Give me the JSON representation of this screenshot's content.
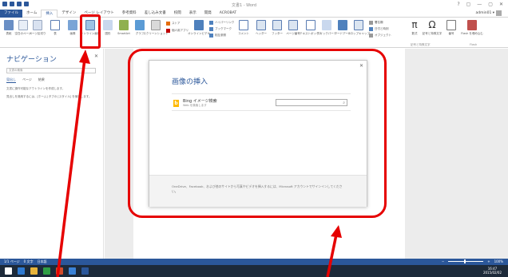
{
  "window": {
    "title": "文書1 - Word",
    "controls": [
      "?",
      "▢",
      "—",
      "▢",
      "✕"
    ]
  },
  "ribbon_tabs": [
    {
      "label": "ファイル",
      "kind": "file"
    },
    {
      "label": "ホーム",
      "kind": ""
    },
    {
      "label": "挿入",
      "kind": "active"
    },
    {
      "label": "デザイン",
      "kind": ""
    },
    {
      "label": "ページ レイアウト",
      "kind": ""
    },
    {
      "label": "参考資料",
      "kind": ""
    },
    {
      "label": "差し込み文書",
      "kind": ""
    },
    {
      "label": "校閲",
      "kind": ""
    },
    {
      "label": "表示",
      "kind": ""
    },
    {
      "label": "開発",
      "kind": ""
    },
    {
      "label": "ACROBAT",
      "kind": ""
    }
  ],
  "user": {
    "name": "admin01 ▾"
  },
  "ribbon": {
    "cover": "表紙",
    "blank": "空白のページ",
    "break": "ページ区切り",
    "table": "表",
    "picture": "画像",
    "online_picture": "オンライン画像",
    "shapes": "図形",
    "smartart": "SmartArt",
    "graph": "グラフ",
    "screenshot": "スクリーンショット",
    "store": "ストア",
    "my_apps": "個人用アプリ",
    "online_video": "オンラインビデオ",
    "link": "ハイパーリンク",
    "bookmark": "ブックマーク",
    "crossref": "相互参照",
    "comment": "コメント",
    "header": "ヘッダー",
    "footer": "フッター",
    "page_no": "ページ番号",
    "textbox": "テキストボックス",
    "quickparts": "クイックパーツ",
    "wordart": "ワードアート",
    "dropcap": "ドロップキャップ",
    "signature": "署名欄",
    "datetime": "日付と時刻",
    "object": "オブジェクト",
    "equation": "数式",
    "symbol": "記号と特殊文字",
    "number": "番号",
    "flash": "Flash を埋め込む",
    "group_symbols": "記号と特殊文字",
    "group_flash": "Flash",
    "equation_glyph": "π",
    "symbol_glyph": "Ω"
  },
  "navigation": {
    "title": "ナビゲーション",
    "search_placeholder": "文書の検索",
    "tabs": [
      "見出し",
      "ページ",
      "結果"
    ],
    "text1": "文書に操作可能なアウトラインを作成します。",
    "text2": "見出しを適用するには、[ホーム] タブの [スタイル] を使用します。",
    "close": "✕"
  },
  "dialog": {
    "title": "画像の挿入",
    "bing_letter": "b",
    "bing_name": "Bing イメージ検索",
    "bing_sub": "Web を検索します",
    "search_icon_glyph": "⌕",
    "close": "✕",
    "footer": "OneDrive、Facebook、および他のサイトから写真やビデオを挿入するには、Microsoft アカウントでサインインしてください。"
  },
  "statusbar": {
    "page": "1/1 ページ",
    "words": "0 文字",
    "lang": "日本語",
    "zoom": "100%"
  },
  "taskbar": {
    "time": "16:47",
    "date": "2015/02/02"
  },
  "colors": {
    "accent": "#2b579a",
    "highlight": "#e60000",
    "bing": "#ffb900"
  }
}
